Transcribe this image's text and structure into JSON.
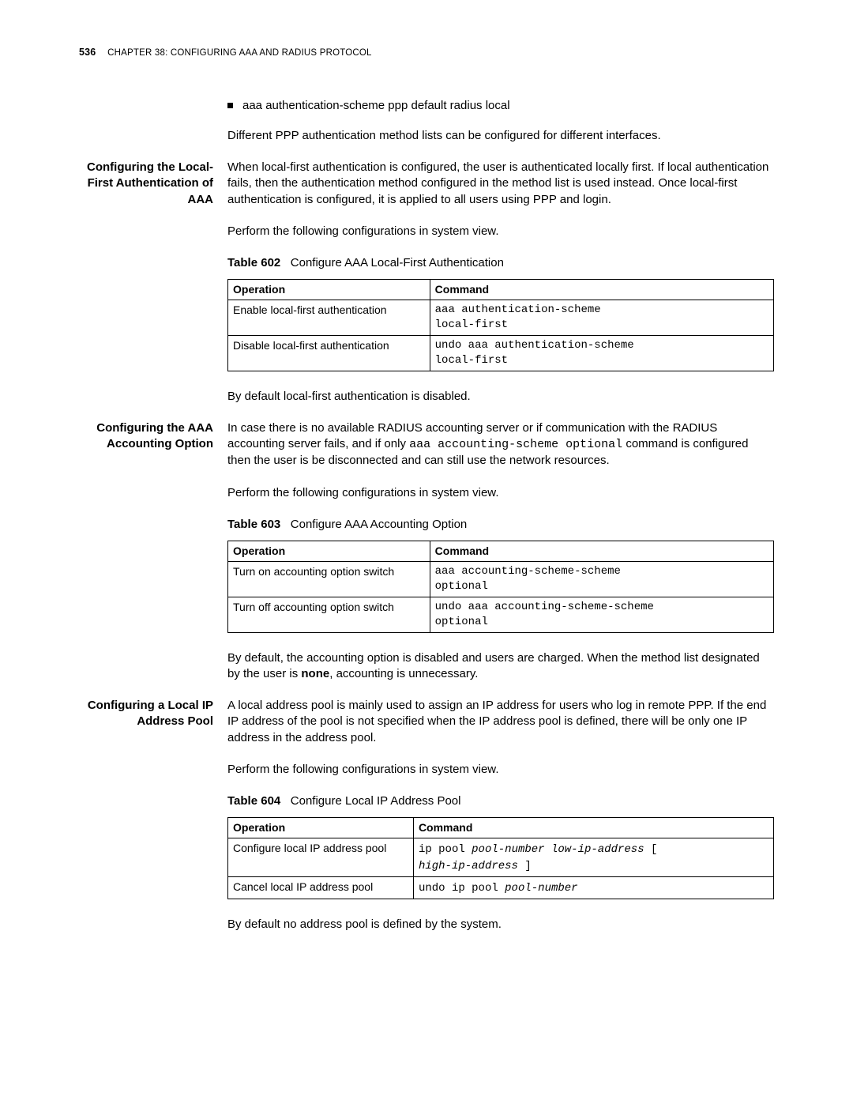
{
  "header": {
    "page_no": "536",
    "chapter": "CHAPTER 38: CONFIGURING AAA AND RADIUS PROTOCOL"
  },
  "intro": {
    "bullet": "aaa authentication-scheme ppp default radius local",
    "para": "Different PPP authentication method lists can be configured for different interfaces."
  },
  "s1": {
    "head": "Configuring the Local-First Authentication of AAA",
    "p1": "When local-first authentication is configured, the user is authenticated locally first. If local authentication fails, then the authentication method configured in the method list is used instead. Once local-first authentication is configured, it is applied to all users using PPP and login.",
    "p2": "Perform the following configurations in system view.",
    "tab_label": "Table 602",
    "tab_title": "Configure AAA Local-First Authentication",
    "th1": "Operation",
    "th2": "Command",
    "r1c1": "Enable local-first authentication",
    "r1c2a": "aaa authentication-scheme",
    "r1c2b": "local-first",
    "r2c1": "Disable local-first authentication",
    "r2c2a": "undo aaa authentication-scheme",
    "r2c2b": "local-first",
    "p3": "By default local-first authentication is disabled."
  },
  "s2": {
    "head": "Configuring the AAA Accounting Option",
    "p1a": "In case there is no available RADIUS accounting server or if communication with the RADIUS accounting server fails, and if only ",
    "p1code": "aaa accounting-scheme optional",
    "p1b": " command is configured then the user is be disconnected and can still use the network resources.",
    "p2": "Perform the following configurations in system view.",
    "tab_label": "Table 603",
    "tab_title": "Configure AAA Accounting Option",
    "th1": "Operation",
    "th2": "Command",
    "r1c1": "Turn on accounting option switch",
    "r1c2a": "aaa accounting-scheme-scheme",
    "r1c2b": "optional",
    "r2c1": "Turn off accounting option switch",
    "r2c2a": "undo aaa accounting-scheme-scheme",
    "r2c2b": "optional",
    "p3a": "By default, the accounting option is disabled and users are charged. When the method list designated by the user is ",
    "p3b": "none",
    "p3c": ", accounting is unnecessary."
  },
  "s3": {
    "head": "Configuring a Local IP Address Pool",
    "p1": "A local address pool is mainly used to assign an IP address for users who log in remote PPP. If the end IP address of the pool is not specified when the IP address pool is defined, there will be only one IP address in the address pool.",
    "p2": "Perform the following configurations in system view.",
    "tab_label": "Table 604",
    "tab_title": "Configure Local IP Address Pool",
    "th1": "Operation",
    "th2": "Command",
    "r1c1": "Configure local IP address pool",
    "r1c2_a": "ip pool ",
    "r1c2_b": "pool-number low-ip-address",
    "r1c2_c": " [ ",
    "r1c2_d": "high-ip-address",
    "r1c2_e": " ]",
    "r2c1": "Cancel local IP address pool",
    "r2c2_a": "undo ip pool ",
    "r2c2_b": "pool-number",
    "p3": "By default no address pool is defined by the system."
  }
}
